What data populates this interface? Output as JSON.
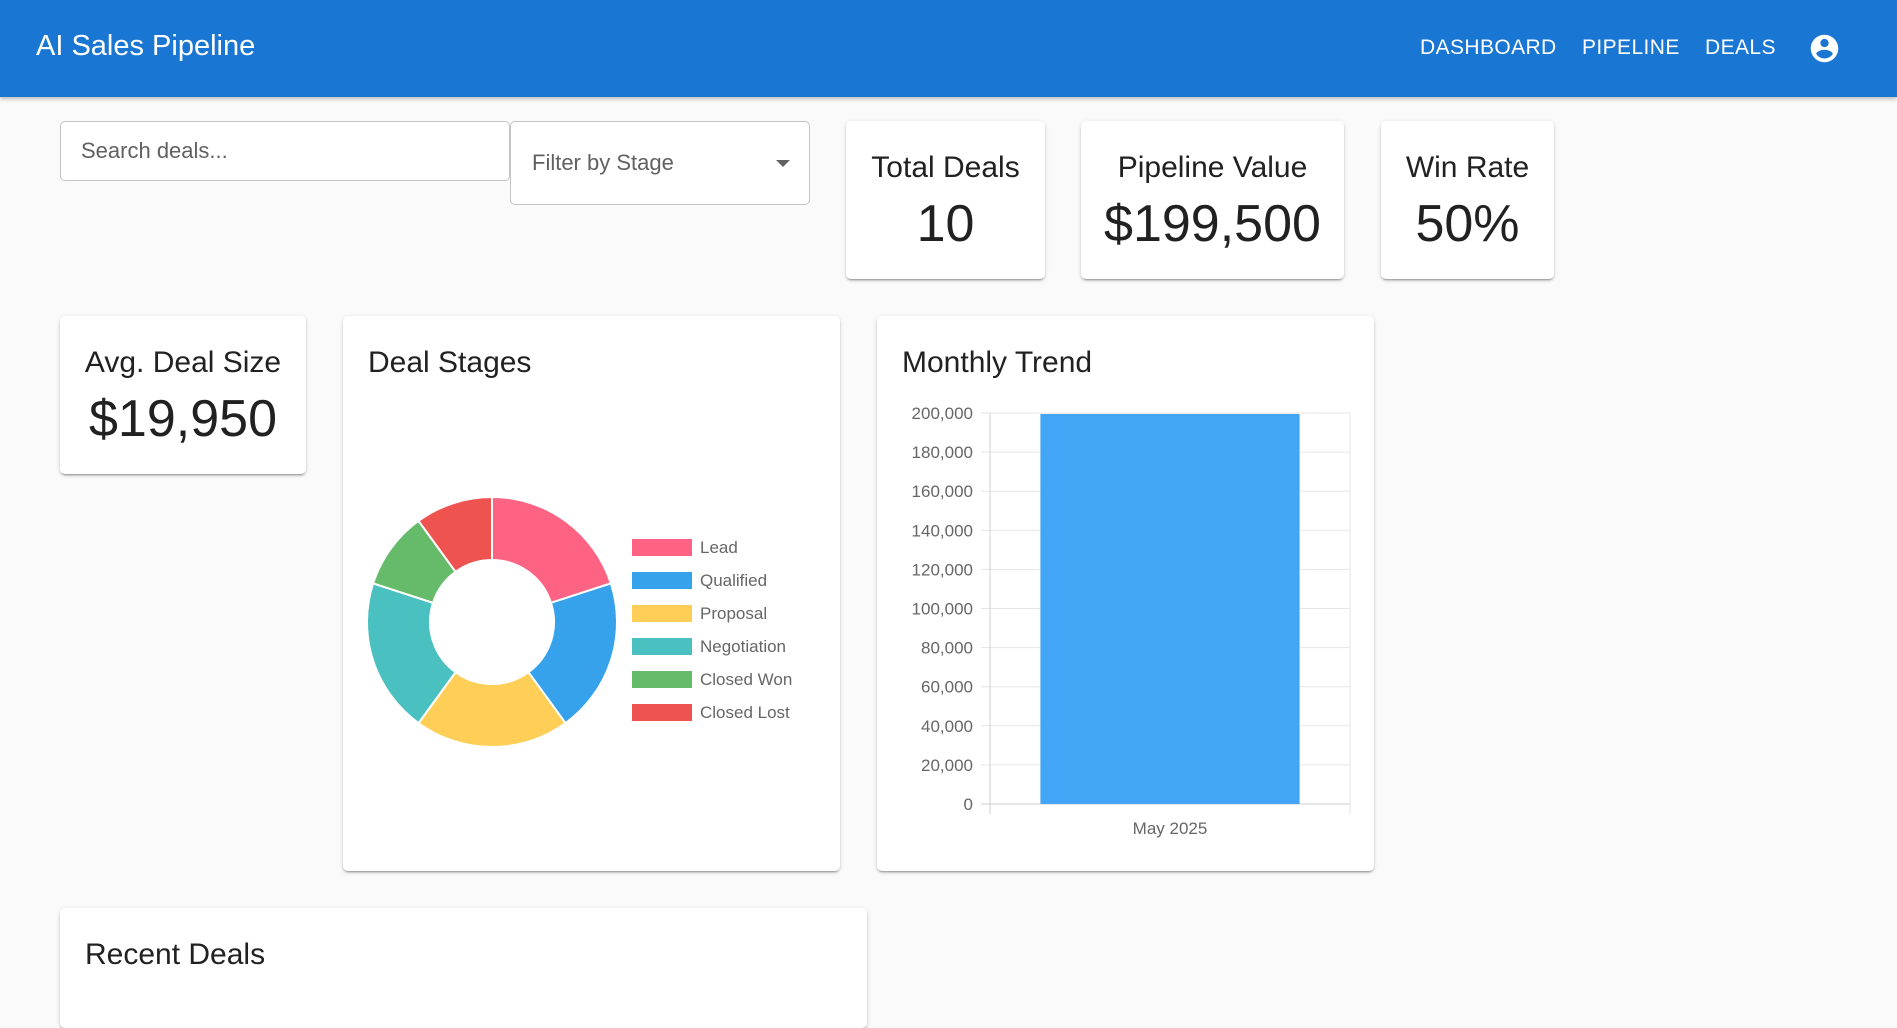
{
  "app": {
    "title": "AI Sales Pipeline",
    "nav": [
      {
        "label": "DASHBOARD"
      },
      {
        "label": "PIPELINE"
      },
      {
        "label": "DEALS"
      }
    ],
    "account_icon": "account-circle-icon"
  },
  "filters": {
    "search_placeholder": "Search deals...",
    "stage_placeholder": "Filter by Stage"
  },
  "stats": {
    "total_deals": {
      "title": "Total Deals",
      "value": "10"
    },
    "pipeline_value": {
      "title": "Pipeline Value",
      "value": "$199,500"
    },
    "win_rate": {
      "title": "Win Rate",
      "value": "50%"
    },
    "avg_deal_size": {
      "title": "Avg. Deal Size",
      "value": "$19,950"
    }
  },
  "deal_stages": {
    "title": "Deal Stages"
  },
  "monthly_trend": {
    "title": "Monthly Trend"
  },
  "recent_deals": {
    "title": "Recent Deals"
  },
  "colors": {
    "appbar": "#1976d2",
    "bar": "#42a5f5"
  },
  "chart_data": [
    {
      "type": "pie",
      "variant": "doughnut",
      "title": "",
      "legend_position": "right",
      "categories": [
        "Lead",
        "Qualified",
        "Proposal",
        "Negotiation",
        "Closed Won",
        "Closed Lost"
      ],
      "values": [
        2,
        2,
        2,
        2,
        1,
        1
      ],
      "colors": [
        "#ff6384",
        "#36a2eb",
        "#ffce56",
        "#4bc0c0",
        "#66bb6a",
        "#ef5350"
      ]
    },
    {
      "type": "bar",
      "title": "",
      "categories": [
        "May 2025"
      ],
      "values": [
        199500
      ],
      "ylim": [
        0,
        200000
      ],
      "yticks": [
        "0",
        "20,000",
        "40,000",
        "60,000",
        "80,000",
        "100,000",
        "120,000",
        "140,000",
        "160,000",
        "180,000",
        "200,000"
      ],
      "grid": true,
      "color": "#42a5f5"
    }
  ]
}
